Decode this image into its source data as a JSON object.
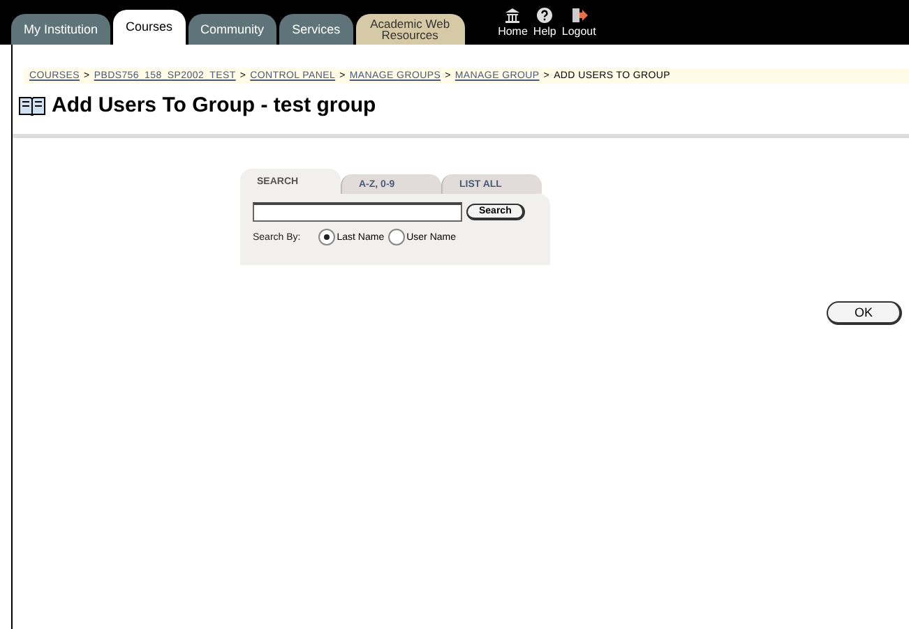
{
  "top_tabs": [
    {
      "label": "My Institution",
      "selected": false,
      "kind": "plain"
    },
    {
      "label": "Courses",
      "selected": true,
      "kind": "plain"
    },
    {
      "label": "Community",
      "selected": false,
      "kind": "plain"
    },
    {
      "label": "Services",
      "selected": false,
      "kind": "plain"
    },
    {
      "label": "Academic Web Resources",
      "selected": false,
      "kind": "special"
    }
  ],
  "top_links": [
    {
      "label": "Home",
      "kind": "home"
    },
    {
      "label": "Help",
      "kind": "help"
    },
    {
      "label": "Logout",
      "kind": "logout"
    }
  ],
  "breadcrumb": [
    {
      "label": "COURSES",
      "link": true
    },
    {
      "separator": ">",
      "label": "PBDS756_158_SP2002_TEST",
      "link": true
    },
    {
      "separator": ">",
      "label": "CONTROL PANEL",
      "link": true
    },
    {
      "separator": ">",
      "label": "MANAGE GROUPS",
      "link": true
    },
    {
      "separator": ">",
      "label": "MANAGE GROUP",
      "link": true
    },
    {
      "separator": ">",
      "label": "ADD USERS TO GROUP",
      "link": false
    }
  ],
  "page_title": "Add Users To Group - test group",
  "search_tabs": [
    {
      "label": "SEARCH",
      "selected": true
    },
    {
      "label": "A-Z, 0-9",
      "selected": false
    },
    {
      "label": "LIST ALL",
      "selected": false
    }
  ],
  "search_button": "Search",
  "search_by_label": "Search By:",
  "search_by_options": [
    {
      "label": "Last Name",
      "selected": true
    },
    {
      "label": "User Name",
      "selected": false
    }
  ],
  "ok_button": "OK"
}
